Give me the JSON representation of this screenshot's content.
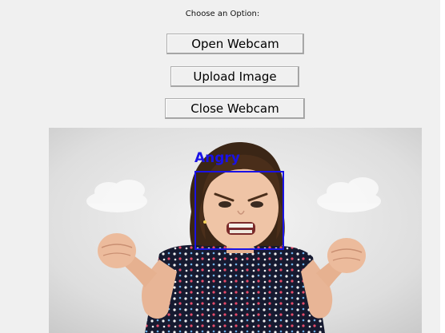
{
  "prompt": "Choose an Option:",
  "buttons": {
    "open_webcam": "Open Webcam",
    "upload_image": "Upload Image",
    "close_webcam": "Close Webcam"
  },
  "detection": {
    "label": "Angry",
    "box_color": "#1a12e6"
  }
}
